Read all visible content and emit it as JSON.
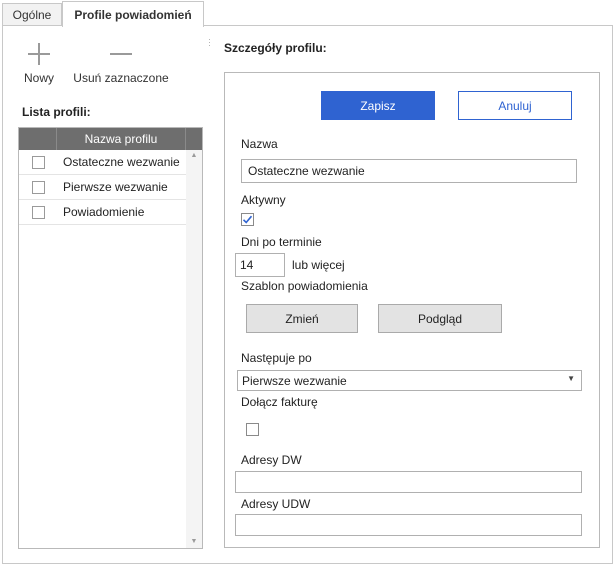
{
  "tabs": [
    {
      "label": "Ogólne"
    },
    {
      "label": "Profile powiadomień"
    }
  ],
  "toolbar": {
    "new_label": "Nowy",
    "delete_label": "Usuń zaznaczone"
  },
  "list": {
    "title": "Lista profili:",
    "column_header": "Nazwa profilu",
    "rows": [
      {
        "name": "Ostateczne wezwanie",
        "checked": false
      },
      {
        "name": "Pierwsze wezwanie",
        "checked": false
      },
      {
        "name": "Powiadomienie",
        "checked": false
      }
    ]
  },
  "details": {
    "title": "Szczegóły profilu:",
    "save_label": "Zapisz",
    "cancel_label": "Anuluj",
    "name_label": "Nazwa",
    "name_value": "Ostateczne wezwanie",
    "active_label": "Aktywny",
    "active_checked": true,
    "days_label": "Dni po terminie",
    "days_value": "14",
    "days_suffix": "lub więcej",
    "template_label": "Szablon powiadomienia",
    "change_label": "Zmień",
    "preview_label": "Podgląd",
    "follows_label": "Następuje po",
    "follows_value": "Pierwsze wezwanie",
    "attach_label": "Dołącz fakturę",
    "attach_checked": false,
    "to_label": "Adresy DW",
    "to_value": "",
    "bcc_label": "Adresy UDW",
    "bcc_value": ""
  },
  "colors": {
    "accent": "#2f63d1",
    "list_header_bg": "#6e6e6e"
  }
}
